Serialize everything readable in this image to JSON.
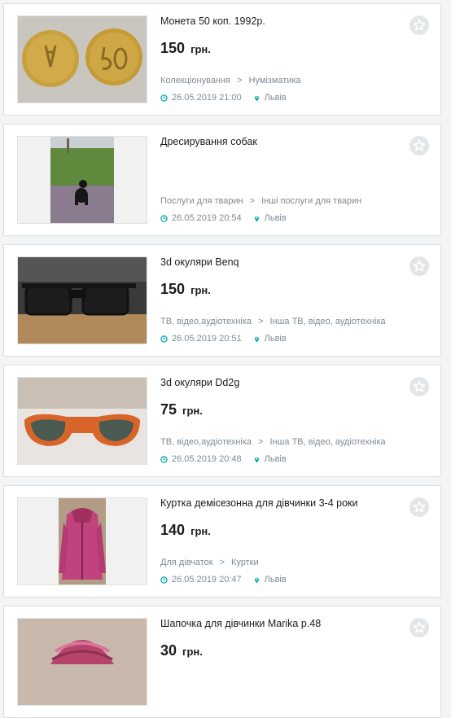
{
  "listings": [
    {
      "title": "Монета 50 коп. 1992р.",
      "price": "150",
      "currency": "грн.",
      "category": "Колекціонування",
      "subcategory": "Нумізматика",
      "date": "26.05.2019 21:00",
      "city": "Львів",
      "image": "coins-photo"
    },
    {
      "title": "Дресирування собак",
      "price": "",
      "currency": "",
      "category": "Послуги для тварин",
      "subcategory": "Інші послуги для тварин",
      "date": "26.05.2019 20:54",
      "city": "Львів",
      "image": "dog-photo"
    },
    {
      "title": "3d окуляри Benq",
      "price": "150",
      "currency": "грн.",
      "category": "ТВ, відео,аудіотехніка",
      "subcategory": "Інша ТВ, відео, аудіотехніка",
      "date": "26.05.2019 20:51",
      "city": "Львів",
      "image": "black-glasses-photo"
    },
    {
      "title": "3d окуляри Dd2g",
      "price": "75",
      "currency": "грн.",
      "category": "ТВ, відео,аудіотехніка",
      "subcategory": "Інша ТВ, відео, аудіотехніка",
      "date": "26.05.2019 20:48",
      "city": "Львів",
      "image": "orange-glasses-photo"
    },
    {
      "title": "Куртка демісезонна для дівчинки 3-4 роки",
      "price": "140",
      "currency": "грн.",
      "category": "Для дівчаток",
      "subcategory": "Куртки",
      "date": "26.05.2019 20:47",
      "city": "Львів",
      "image": "pink-jacket-photo"
    },
    {
      "title": "Шапочка для дівчинки Marika р.48",
      "price": "30",
      "currency": "грн.",
      "category": "",
      "subcategory": "",
      "date": "",
      "city": "",
      "image": "knit-hat-photo"
    }
  ],
  "icons": {
    "favorite": "star-icon",
    "time": "clock-icon",
    "location": "pin-icon"
  },
  "colors": {
    "accent": "#00a8b0",
    "muted_text": "#7f8a94",
    "background": "#f2f4f5"
  }
}
